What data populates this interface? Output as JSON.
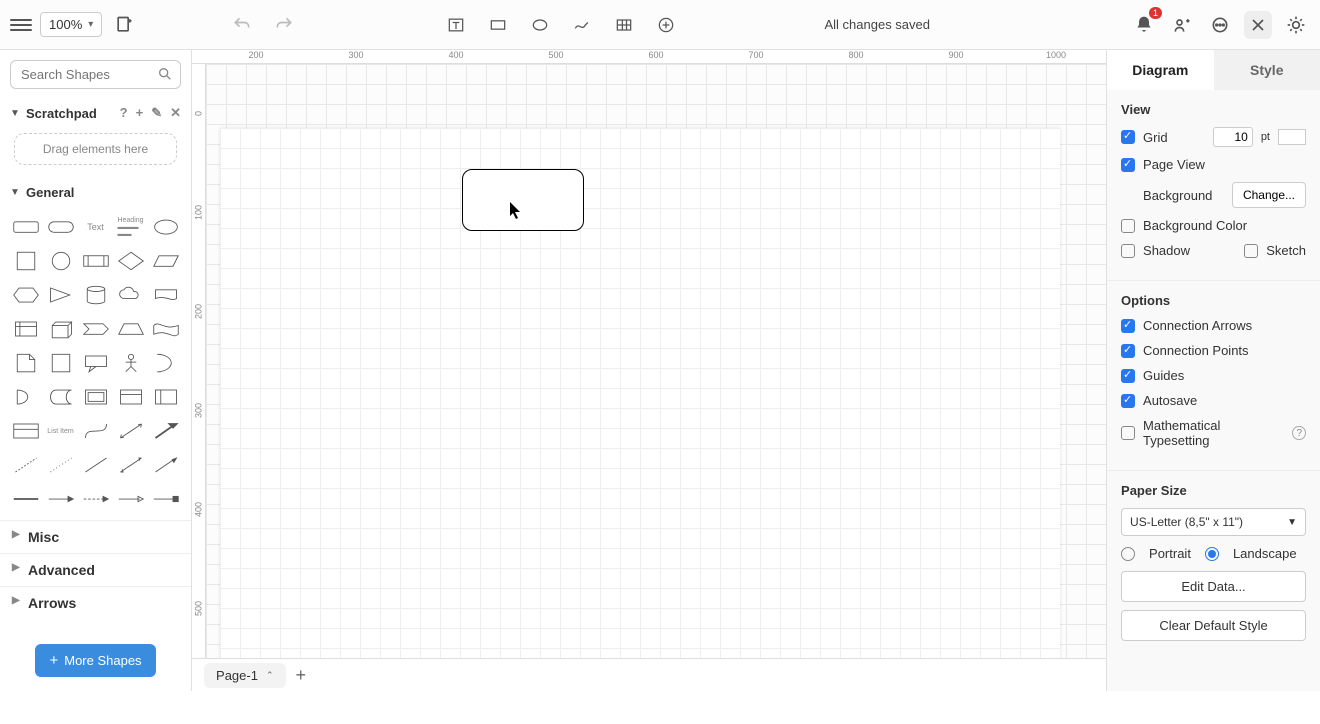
{
  "toolbar": {
    "zoom": "100%",
    "status": "All changes saved",
    "notif_count": "1"
  },
  "sidebar": {
    "search_placeholder": "Search Shapes",
    "scratchpad_label": "Scratchpad",
    "scratch_drop": "Drag elements here",
    "sections": {
      "general": "General",
      "misc": "Misc",
      "advanced": "Advanced",
      "arrows": "Arrows"
    },
    "more_shapes": "More Shapes"
  },
  "canvas": {
    "ruler_h": [
      "200",
      "300",
      "400",
      "500",
      "600",
      "700",
      "800",
      "900",
      "1000"
    ],
    "ruler_v": [
      "0",
      "100",
      "200",
      "300",
      "400",
      "500"
    ],
    "active_tab": "Page-1"
  },
  "rpanel": {
    "tab_diagram": "Diagram",
    "tab_style": "Style",
    "view": {
      "title": "View",
      "grid": "Grid",
      "grid_value": "10",
      "grid_unit": "pt",
      "page_view": "Page View",
      "background": "Background",
      "change": "Change...",
      "bg_color": "Background Color",
      "shadow": "Shadow",
      "sketch": "Sketch"
    },
    "options": {
      "title": "Options",
      "conn_arrows": "Connection Arrows",
      "conn_points": "Connection Points",
      "guides": "Guides",
      "autosave": "Autosave",
      "math": "Mathematical Typesetting"
    },
    "paper": {
      "title": "Paper Size",
      "size": "US-Letter (8,5\" x 11\")",
      "portrait": "Portrait",
      "landscape": "Landscape",
      "edit_data": "Edit Data...",
      "clear_style": "Clear Default Style"
    }
  }
}
